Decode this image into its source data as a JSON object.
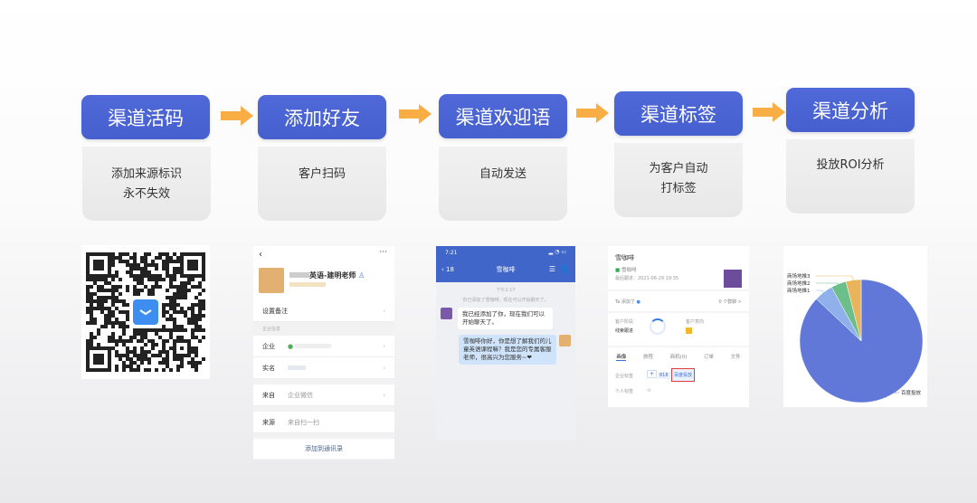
{
  "steps": [
    {
      "title": "渠道活码",
      "desc": [
        "添加来源标识",
        "永不失效"
      ]
    },
    {
      "title": "添加好友",
      "desc": [
        "客户扫码"
      ]
    },
    {
      "title": "渠道欢迎语",
      "desc": [
        "自动发送"
      ]
    },
    {
      "title": "渠道标签",
      "desc": [
        "为客户自动",
        "打标签"
      ]
    },
    {
      "title": "渠道分析",
      "desc": [
        "投放ROI分析"
      ]
    }
  ],
  "friend_card": {
    "name": "英语-建明老师",
    "remark": "设置备注",
    "section": "企业信息",
    "company_label": "企业",
    "realname_label": "实名",
    "from_label": "来自",
    "from_value": "企业微信",
    "source_label": "来源",
    "source_value": "来自扫一扫",
    "add_btn": "添加到通讯录"
  },
  "chat": {
    "time": "7:21",
    "back_count": "18",
    "contact": "雪咖啡",
    "time_sep": "下午2:17",
    "system": "你已添加了雪咖啡，现在可以开始聊天了。",
    "msg1": "我已经添加了你，现在我们可以开始聊天了。",
    "msg2": "雪咖啡你好，你是想了解我们的儿童英语课程嘛？我是您的专属客服老师，很高兴为您服务~❤"
  },
  "tag_card": {
    "name": "雪咖啡",
    "wechat": "雪咖啡",
    "last_follow": "最后跟进：2021-06-29 19:35",
    "ta_added": "Ta 添加了",
    "groups": "0 个群聊 >",
    "stage_label": "客户阶段",
    "stage_value": "线索跟进",
    "intent_label": "客户意向",
    "tabs": [
      "画像",
      "旅程",
      "商机(0)",
      "订单",
      "文件"
    ],
    "corp_tag_label": "企业标签",
    "tag1": "818",
    "tag2": "百度投放",
    "personal_tag_label": "个人标签"
  },
  "chart_data": {
    "type": "pie",
    "labels": [
      "百度投放",
      "商场地推1",
      "商场地推2",
      "商场地推3"
    ],
    "values": [
      87,
      5,
      4,
      4
    ],
    "colors": [
      "#6178d8",
      "#8fb0ea",
      "#6cbf8a",
      "#e9b45c"
    ]
  },
  "colors": {
    "header": "#4a63d3",
    "arrow": "#f9ad45"
  }
}
